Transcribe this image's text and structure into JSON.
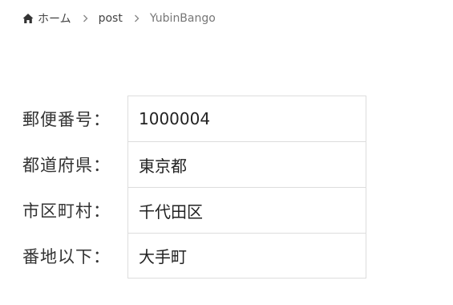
{
  "breadcrumb": {
    "home_label": "ホーム",
    "post_label": "post",
    "current_label": "YubinBango"
  },
  "form": {
    "rows": [
      {
        "label": "郵便番号：",
        "value": "1000004"
      },
      {
        "label": "都道府県：",
        "value": "東京都"
      },
      {
        "label": "市区町村：",
        "value": "千代田区"
      },
      {
        "label": "番地以下：",
        "value": "大手町"
      }
    ]
  },
  "icons": {
    "home": "home-icon",
    "separator": "chevron-right-icon"
  }
}
